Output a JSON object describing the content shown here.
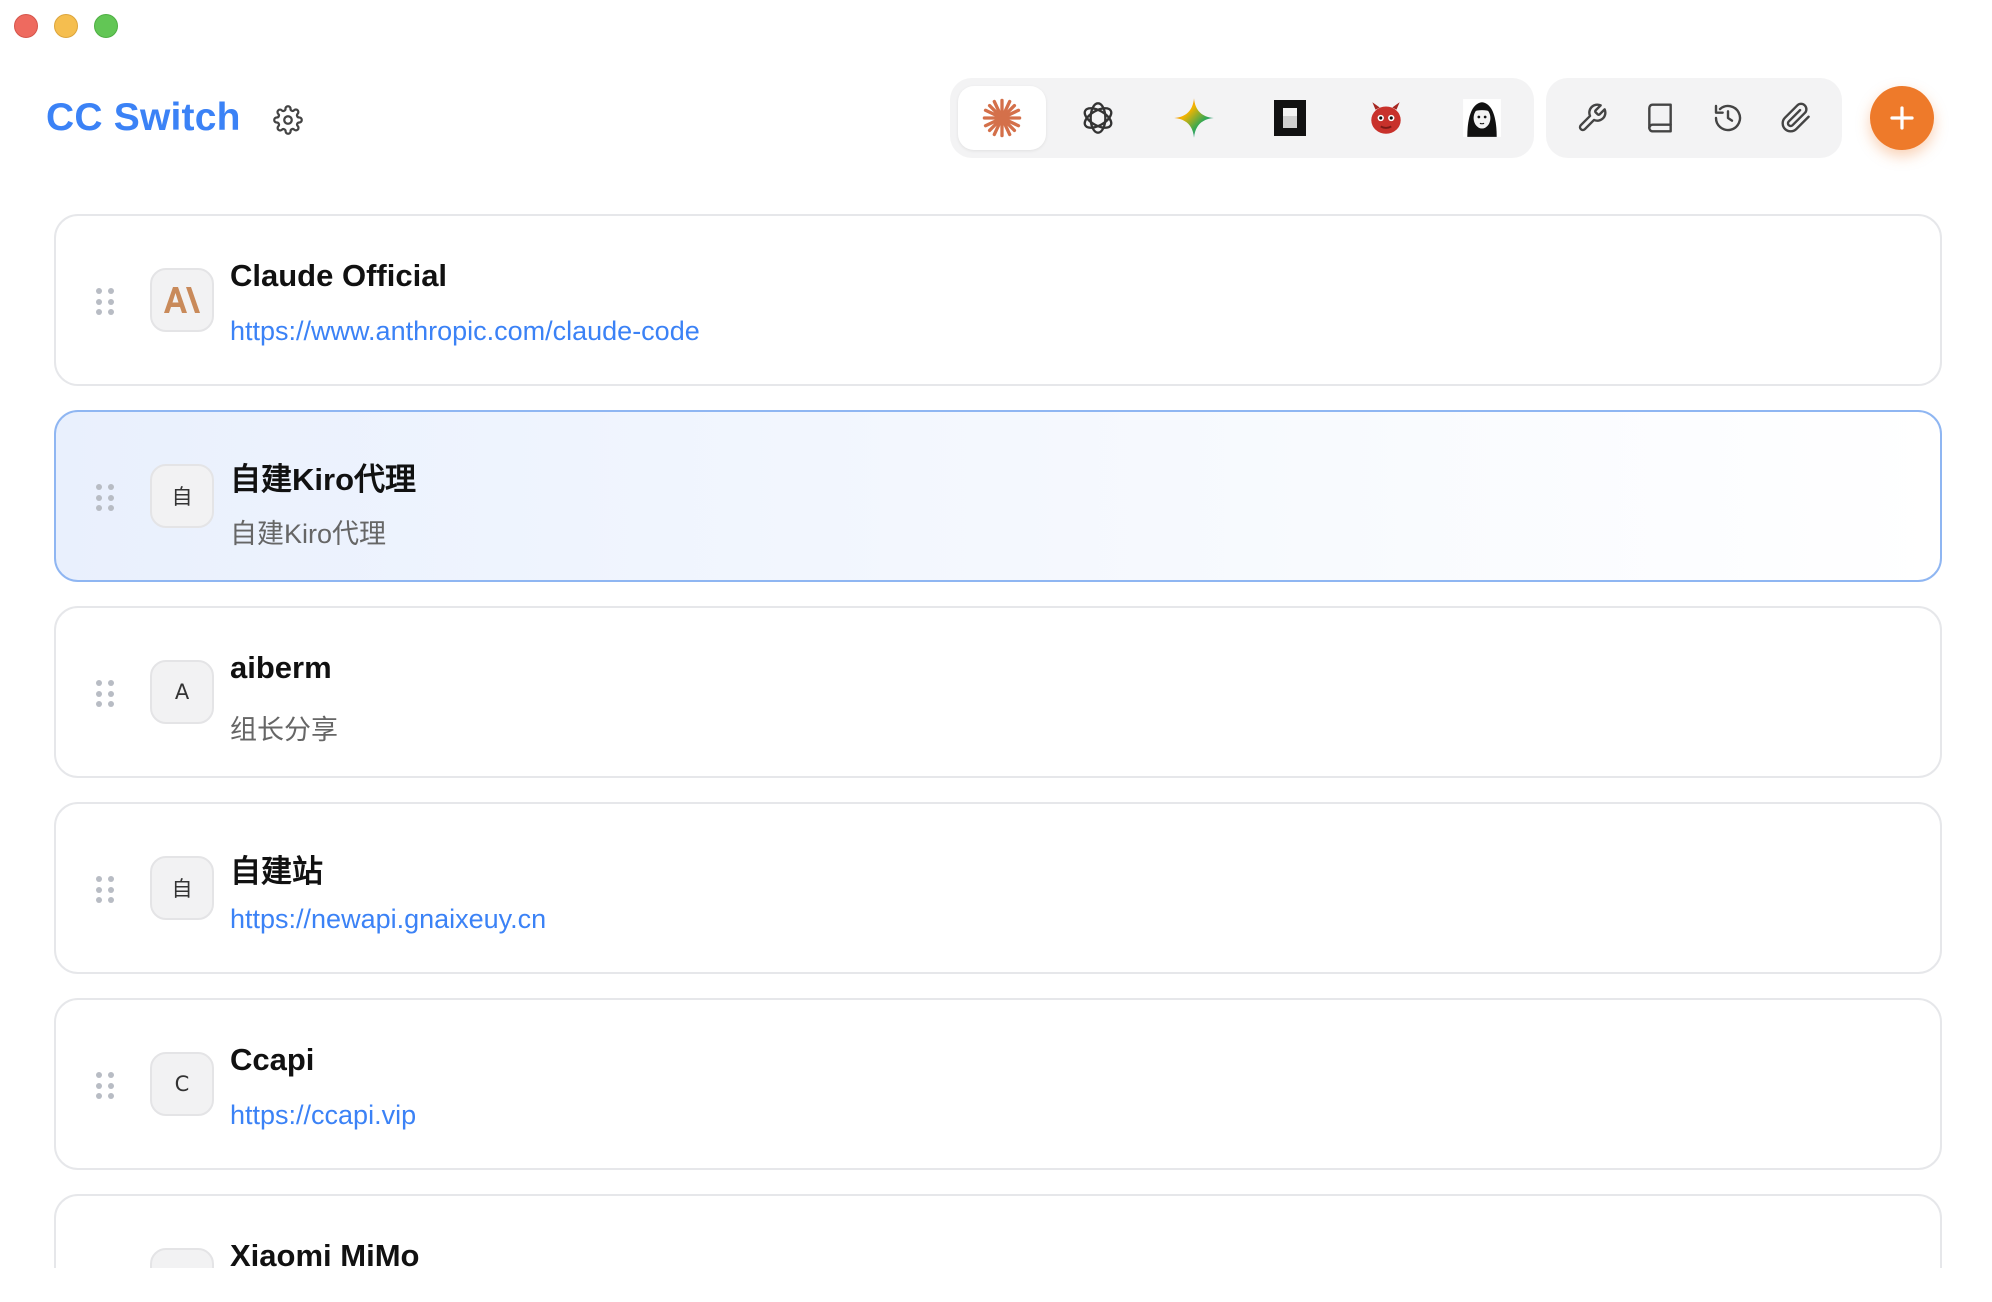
{
  "window": {
    "controls": [
      "close",
      "minimize",
      "zoom"
    ]
  },
  "header": {
    "title": "CC Switch",
    "settings_icon": "gear-icon",
    "apps": [
      {
        "name": "Claude",
        "icon": "claude-sparkle-icon",
        "active": true
      },
      {
        "name": "Codex",
        "icon": "openai-icon",
        "active": false
      },
      {
        "name": "Gemini",
        "icon": "gemini-star-icon",
        "active": false
      },
      {
        "name": "Kiro",
        "icon": "black-square-icon",
        "active": false
      },
      {
        "name": "Red Bot",
        "icon": "red-creature-icon",
        "active": false
      },
      {
        "name": "Avatar",
        "icon": "portrait-icon",
        "active": false
      }
    ],
    "tools": [
      {
        "name": "wrench",
        "icon": "wrench-icon"
      },
      {
        "name": "book",
        "icon": "book-icon"
      },
      {
        "name": "history",
        "icon": "history-icon"
      },
      {
        "name": "attachment",
        "icon": "paperclip-icon"
      }
    ],
    "add_icon": "plus-icon",
    "colors": {
      "accent": "#3b82f6",
      "add": "#ee7a2a"
    }
  },
  "providers": [
    {
      "title": "Claude Official",
      "subtitle": "https://www.anthropic.com/claude-code",
      "is_link": true,
      "avatar": "A\\",
      "logo": true,
      "active": false
    },
    {
      "title": "自建Kiro代理",
      "subtitle": "自建Kiro代理",
      "is_link": false,
      "avatar": "自",
      "active": true
    },
    {
      "title": "aiberm",
      "subtitle": "组长分享",
      "is_link": false,
      "avatar": "A",
      "active": false
    },
    {
      "title": "自建站",
      "subtitle": "https://newapi.gnaixeuy.cn",
      "is_link": true,
      "avatar": "自",
      "active": false
    },
    {
      "title": "Ccapi",
      "subtitle": "https://ccapi.vip",
      "is_link": true,
      "avatar": "C",
      "active": false
    },
    {
      "title": "Xiaomi MiMo",
      "subtitle": "",
      "is_link": false,
      "avatar": "",
      "active": false
    }
  ]
}
